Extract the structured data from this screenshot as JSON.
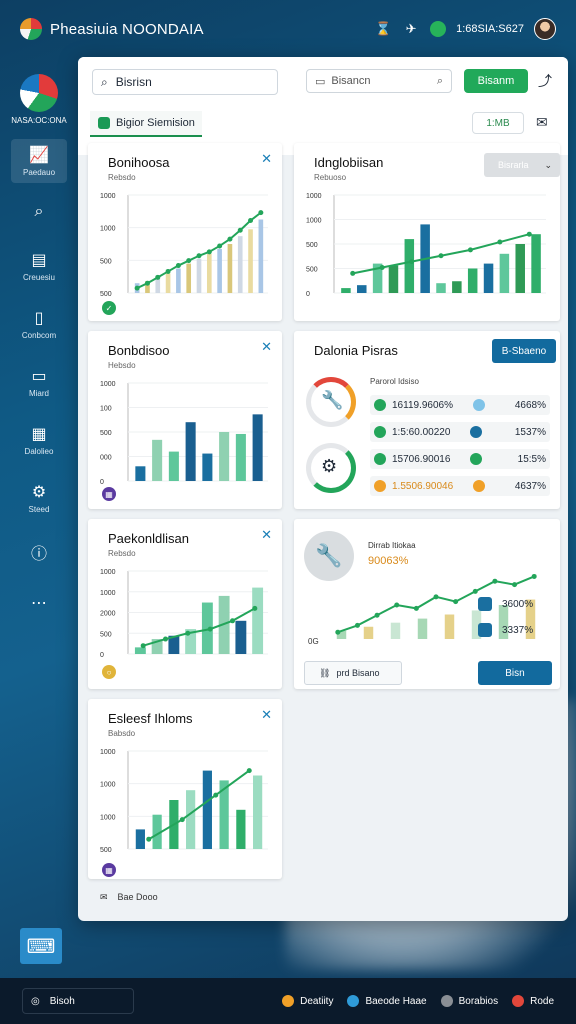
{
  "topbar": {
    "title": "Pheasiuia NOONDAIA",
    "value": "1:68SIA:S627",
    "icons": [
      "hourglass-icon",
      "wind-icon",
      "status-icon",
      "avatar"
    ]
  },
  "sidebar": {
    "logo_text": "NASA:OC:ONA",
    "items": [
      {
        "label": "Paedauo",
        "icon": "chart-icon"
      },
      {
        "label": "",
        "icon": "search-icon"
      },
      {
        "label": "Creuesiu",
        "icon": "grid-icon"
      },
      {
        "label": "Conbcom",
        "icon": "file-icon"
      },
      {
        "label": "Miard",
        "icon": "monitor-icon"
      },
      {
        "label": "Dalolieo",
        "icon": "table-icon"
      },
      {
        "label": "Steed",
        "icon": "settings-icon"
      },
      {
        "label": "",
        "icon": "info-icon"
      },
      {
        "label": "",
        "icon": "more-icon"
      }
    ]
  },
  "header": {
    "search_text": "Bisrisn",
    "search2_text": "Bisancn",
    "green_button": "Bisanm",
    "tab_label": "Bigior Siemision",
    "pill_label": "1:MB",
    "colors": {
      "green": "#21a95a",
      "blue": "#126a9e"
    }
  },
  "cards": {
    "c1": {
      "title": "Bonihoosa",
      "sub": "Rebsdo",
      "ticks": [
        "1000",
        "1000",
        "500",
        "500"
      ]
    },
    "c2": {
      "title": "Idnglobiisan",
      "sub": "Rebuoso",
      "ticks": [
        "1000",
        "1000",
        "500",
        "500",
        "0"
      ],
      "dropdown": "Bisrarla"
    },
    "c3": {
      "title": "Bonbdisoo",
      "sub": "Hebsdo",
      "ticks": [
        "1000",
        "100",
        "500",
        "000",
        "0"
      ]
    },
    "c4": {
      "title": "Dalonia Pisras",
      "button": "B-Sbaeno",
      "sub": "Parorol Idsiso",
      "rows": [
        {
          "text": "16119.9606%",
          "value": "4668%",
          "dot": "#23a55a",
          "mark": "#7fc3e8"
        },
        {
          "text": "1:5:60.00220",
          "value": "1537%",
          "dot": "#23a55a",
          "mark": "#1a6fa0"
        },
        {
          "text": "15706.90016",
          "value": "15:5%",
          "dot": "#23a55a",
          "mark": "#23a55a"
        },
        {
          "text": "1.5506.90046",
          "value": "4637%",
          "dot": "#f0a028",
          "mark": "#f0a028"
        }
      ]
    },
    "c5": {
      "title": "Paekonldlisan",
      "sub": "Rebsdo",
      "ticks": [
        "1000",
        "1000",
        "2000",
        "500",
        "0"
      ]
    },
    "c6": {
      "title": "Dirrab Itiokaa",
      "percent": "90063%",
      "tick0": "0G",
      "rows": [
        {
          "value": "3600%"
        },
        {
          "value": "3337%"
        }
      ],
      "ghost_button": "prd Bisano",
      "blue_button": "Bisn"
    },
    "c7": {
      "title": "Esleesf Ihloms",
      "sub": "Babsdo",
      "ticks": [
        "1000",
        "1000",
        "1000",
        "500"
      ]
    }
  },
  "panel_footer": {
    "text": "Bae Dooo"
  },
  "footer": {
    "left": "Bisoh",
    "items": [
      {
        "label": "Deatiity",
        "color": "#f0a028"
      },
      {
        "label": "Baeode Haae",
        "color": "#2f9bd8"
      },
      {
        "label": "Borabios",
        "color": "#8a8f95"
      },
      {
        "label": "Rode",
        "color": "#e2473b"
      }
    ]
  },
  "chart_data": [
    {
      "type": "bar",
      "title": "Bonihoosa",
      "values": [
        10,
        12,
        18,
        20,
        25,
        30,
        35,
        40,
        45,
        50,
        58,
        65,
        75
      ],
      "line": [
        5,
        10,
        16,
        22,
        28,
        33,
        38,
        42,
        48,
        55,
        64,
        74,
        82
      ],
      "ylim": [
        0,
        100
      ],
      "yticks": [
        "1000",
        "1000",
        "500",
        "500"
      ]
    },
    {
      "type": "bar",
      "title": "Idnglobiisan",
      "values": [
        5,
        8,
        30,
        28,
        55,
        70,
        10,
        12,
        25,
        30,
        40,
        50,
        60
      ],
      "line": [
        20,
        26,
        32,
        38,
        44,
        52,
        60
      ],
      "ylim": [
        0,
        100
      ],
      "yticks": [
        "1000",
        "1000",
        "500",
        "500",
        "0"
      ]
    },
    {
      "type": "bar",
      "title": "Bonbdisoo",
      "values": [
        15,
        42,
        30,
        60,
        28,
        50,
        48,
        68
      ],
      "ylim": [
        0,
        100
      ],
      "yticks": [
        "1000",
        "100",
        "500",
        "000",
        "0"
      ]
    },
    {
      "type": "bar",
      "title": "Paekonldlisan",
      "values": [
        8,
        18,
        22,
        30,
        62,
        70,
        40,
        80
      ],
      "line": [
        10,
        18,
        25,
        30,
        40,
        55
      ],
      "ylim": [
        0,
        100
      ],
      "yticks": [
        "1000",
        "1000",
        "2000",
        "500",
        "0"
      ]
    },
    {
      "type": "bar",
      "title": "Dirrab Itiokaa",
      "values": [
        12,
        18,
        24,
        30,
        36,
        42,
        50,
        58
      ],
      "line": [
        10,
        20,
        35,
        50,
        45,
        62,
        55,
        70,
        85,
        80,
        92
      ],
      "ylim": [
        0,
        100
      ]
    },
    {
      "type": "bar",
      "title": "Esleesf Ihloms",
      "values": [
        20,
        35,
        50,
        60,
        80,
        70,
        40,
        75
      ],
      "line": [
        10,
        30,
        55,
        80
      ],
      "ylim": [
        0,
        100
      ],
      "yticks": [
        "1000",
        "1000",
        "1000",
        "500"
      ]
    }
  ]
}
